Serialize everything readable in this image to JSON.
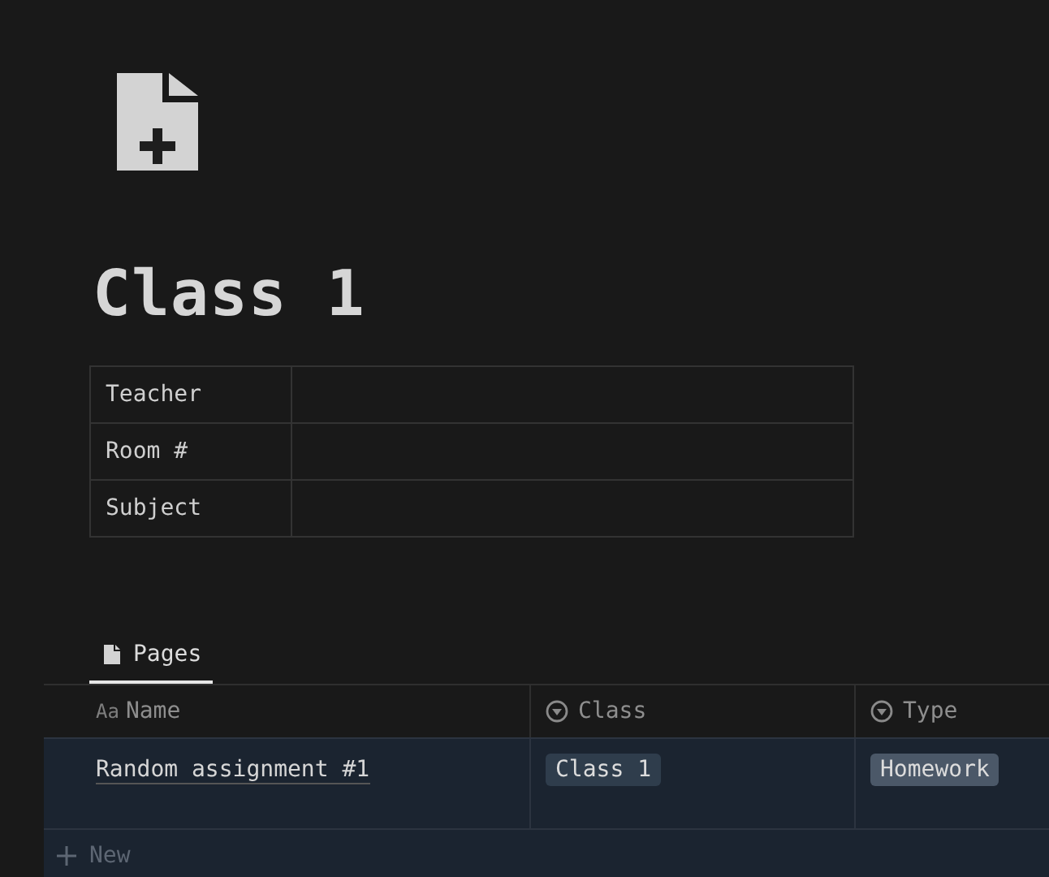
{
  "page": {
    "title": "Class 1"
  },
  "properties": [
    {
      "label": "Teacher"
    },
    {
      "label": "Room #"
    },
    {
      "label": "Subject"
    }
  ],
  "views": [
    {
      "label": "Pages",
      "selected": true
    }
  ],
  "table": {
    "columns": [
      {
        "kind": "title",
        "icon_text": "Aa",
        "label": "Name"
      },
      {
        "kind": "select",
        "label": "Class"
      },
      {
        "kind": "select",
        "label": "Type"
      }
    ],
    "rows": [
      {
        "name": "Random assignment #1",
        "class": {
          "label": "Class 1",
          "color": "#2f3d4c"
        },
        "type": {
          "label": "Homework",
          "color": "#4b5868"
        }
      }
    ],
    "new_label": "New"
  }
}
